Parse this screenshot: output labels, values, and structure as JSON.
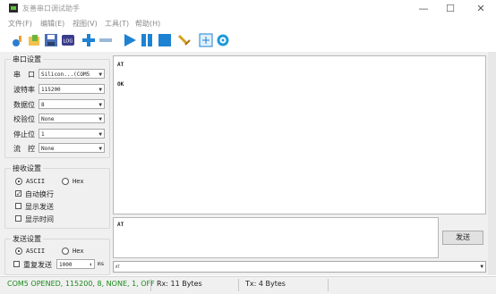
{
  "window": {
    "title": "友善串口调试助手",
    "minimize": "—",
    "maximize": "☐",
    "close": "✕"
  },
  "menu": [
    {
      "label": "文件(F)"
    },
    {
      "label": "编辑(E)"
    },
    {
      "label": "视图(V)"
    },
    {
      "label": "工具(T)"
    },
    {
      "label": "帮助(H)"
    }
  ],
  "toolbar": {
    "icons": [
      "open-icon",
      "folder-icon",
      "save-icon",
      "log-icon",
      "add-icon",
      "remove-icon",
      "play-icon",
      "pause-icon",
      "stop-icon",
      "clear-icon",
      "crosshair-icon",
      "settings-icon"
    ],
    "log_text": "LOG"
  },
  "serial_settings": {
    "title": "串口设置",
    "port_label": "串　口",
    "port_value": "Silicon...(COM5",
    "baud_label": "波特率",
    "baud_value": "115200",
    "data_label": "数据位",
    "data_value": "8",
    "parity_label": "校验位",
    "parity_value": "None",
    "stop_label": "停止位",
    "stop_value": "1",
    "flow_label": "流　控",
    "flow_value": "None"
  },
  "receive_settings": {
    "title": "接收设置",
    "ascii_label": "ASCII",
    "hex_label": "Hex",
    "auto_wrap_label": "自动换行",
    "auto_wrap_checked": true,
    "show_send_label": "显示发送",
    "show_send_checked": false,
    "show_time_label": "显示时间",
    "show_time_checked": false
  },
  "send_settings": {
    "title": "发送设置",
    "ascii_label": "ASCII",
    "hex_label": "Hex",
    "repeat_label": "重复发送",
    "repeat_checked": false,
    "interval_value": "1000",
    "interval_unit": "ms"
  },
  "receive_area": {
    "lines": [
      "AT",
      "",
      "OK"
    ]
  },
  "send_area": {
    "text": "AT",
    "send_button": "发送",
    "history_value": "AT"
  },
  "status": {
    "port": "COM5 OPENED, 115200, 8, NONE, 1, OFF",
    "rx": "Rx: 11 Bytes",
    "tx": "Tx: 4 Bytes"
  },
  "colors": {
    "accent": "#1e82d2",
    "status_port": "#1a8a1a",
    "panel": "#f0f0f0"
  }
}
